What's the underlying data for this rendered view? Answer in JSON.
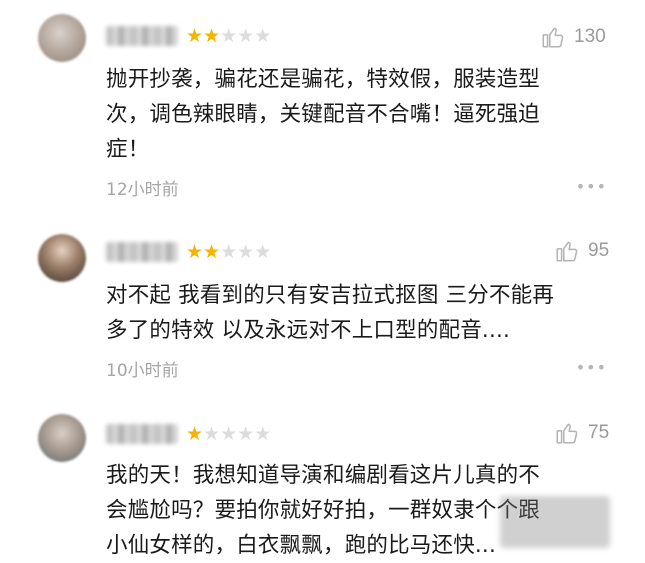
{
  "comments": [
    {
      "stars_filled": 2,
      "stars_total": 5,
      "likes": "130",
      "lines": [
        "抛开抄袭，骗花还是骗花，特效假，服装造型",
        "次，调色辣眼睛，关键配音不合嘴！逼死强迫",
        "症！"
      ],
      "time": "12小时前",
      "more": "•••",
      "icons": [
        "avatar",
        "star-icon",
        "thumbs-up-icon",
        "more-icon"
      ]
    },
    {
      "stars_filled": 2,
      "stars_total": 5,
      "likes": "95",
      "lines": [
        "对不起 我看到的只有安吉拉式抠图 三分不能再",
        "多了的特效 以及永远对不上口型的配音...."
      ],
      "time": "10小时前",
      "more": "•••",
      "icons": [
        "avatar",
        "star-icon",
        "thumbs-up-icon",
        "more-icon"
      ]
    },
    {
      "stars_filled": 1,
      "stars_total": 5,
      "likes": "75",
      "lines": [
        "我的天！我想知道导演和编剧看这片儿真的不",
        "会尴尬吗？要拍你就好好拍，一群奴隶个个跟",
        "小仙女样的，白衣飘飘，跑的比马还快..."
      ],
      "icons": [
        "avatar",
        "star-icon",
        "thumbs-up-icon"
      ]
    }
  ],
  "colors": {
    "star_on": "#f5b400",
    "star_off": "#dcdcdc",
    "meta": "#a5a5a5"
  }
}
